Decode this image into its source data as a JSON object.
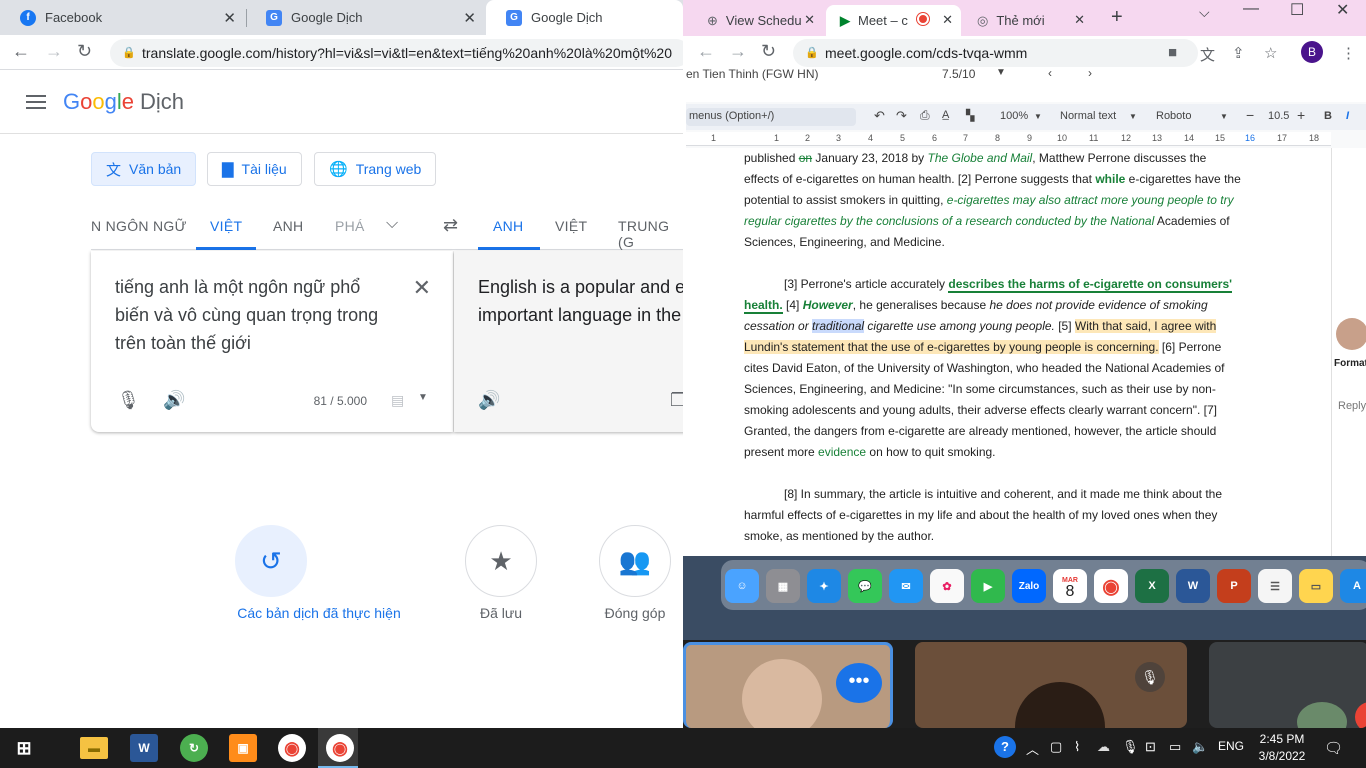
{
  "left_browser": {
    "tabs": [
      {
        "label": "Facebook",
        "icon": "facebook-icon"
      },
      {
        "label": "Google Dịch",
        "icon": "google-translate-icon"
      },
      {
        "label": "Google Dịch",
        "icon": "google-translate-icon"
      }
    ],
    "url": "translate.google.com/history?hl=vi&sl=vi&tl=en&text=tiếng%20anh%20là%20một%20",
    "header": {
      "logo_google": "Google",
      "logo_product": "Dịch"
    },
    "modes": [
      {
        "label": "Văn bản",
        "icon": "translate-icon"
      },
      {
        "label": "Tài liệu",
        "icon": "document-icon"
      },
      {
        "label": "Trang web",
        "icon": "globe-icon"
      }
    ],
    "source_langs": [
      "N NGÔN NGỮ",
      "VIỆT",
      "ANH",
      "PHÁ"
    ],
    "target_langs": [
      "ANH",
      "VIỆT",
      "TRUNG (G"
    ],
    "source_text": "tiếng anh là một ngôn ngữ phổ biến và vô cùng quan trọng trong trên toàn thế giới",
    "target_text_line1": "English is a popular and e",
    "target_text_line2": "important language in the",
    "char_count": "81 / 5.000",
    "shortcuts": [
      {
        "label": "Các bản dịch đã thực hiện",
        "icon": "history-icon"
      },
      {
        "label": "Đã lưu",
        "icon": "star-icon"
      },
      {
        "label": "Đóng góp",
        "icon": "people-icon"
      }
    ]
  },
  "right_browser": {
    "tabs": [
      {
        "label": "View Schedu",
        "icon": "schedule-icon"
      },
      {
        "label": "Meet – c",
        "icon": "meet-icon"
      },
      {
        "label": "Thẻ mới",
        "icon": "chrome-icon"
      }
    ],
    "url": "meet.google.com/cds-tvqa-wmm",
    "avatar_letter": "B",
    "doc": {
      "top_name": "en Tien Thinh (FGW HN)",
      "top_score": "7.5/10",
      "menu_search": "menus (Option+/)",
      "zoom": "100%",
      "style": "Normal text",
      "font": "Roboto",
      "font_size": "10.5",
      "ruler_numbers": [
        "1",
        "1",
        "2",
        "3",
        "4",
        "5",
        "6",
        "7",
        "8",
        "9",
        "10",
        "11",
        "12",
        "13",
        "14",
        "15",
        "16",
        "17",
        "18"
      ],
      "p1_a": "published ",
      "p1_b": "on",
      "p1_c": " January 23, 2018 by ",
      "p1_d": "The Globe and Mail",
      "p1_e": ", Matthew Perrone discusses the effects of e-cigarettes on human health. [2] Perrone suggests that ",
      "p1_f": "while",
      "p1_g": " e-cigarettes have the potential to assist smokers in quitting, ",
      "p1_h": "e-cigarettes may also attract more young people to try regular cigarettes by the conclusions of a research conducted by the National",
      "p1_i": " Academies of Sciences, Engineering, and Medicine.",
      "p2_a": "[3] Perrone's article accurately ",
      "p2_b": "describes the harms of e-cigarette on consumers' health.",
      "p2_c": "[4] ",
      "p2_d": "However",
      "p2_e": ", he generalises because ",
      "p2_f": "he does not provide evidence of smoking cessation or",
      "p2_g": "traditional",
      "p2_h": " cigarette use among young people.",
      "p2_i": " [5] ",
      "p2_j": "With that said, I agree with Lundin's statement that the use of e-cigarettes by young people is concerning.",
      "p2_k": " [6] Perrone cites David Eaton, of the University of Washington, who headed the National Academies of Sciences, Engineering, and Medicine: \"In some circumstances, such as their use by non-smoking adolescents and young adults, their adverse effects clearly warrant concern\". [7] Granted, the dangers from e-cigarette are already mentioned, however, the article should present more ",
      "p2_l": "evidence",
      "p2_m": " on how to quit smoking.",
      "p3": "[8] In summary, the article is intuitive and coherent, and it made me think about the harmful effects of e-cigarettes in my life and about the health of my loved ones when they smoke, as mentioned by the author.",
      "side_format": "Format",
      "side_reply": "Reply"
    }
  },
  "dock": {
    "calendar_month": "MAR",
    "calendar_day": "8",
    "zalo": "Zalo",
    "apps": [
      "finder-icon",
      "launchpad-icon",
      "safari-icon",
      "messages-icon",
      "mail-icon",
      "photos-icon",
      "facetime-icon",
      "zalo-icon",
      "calendar-icon",
      "chrome-icon",
      "excel-icon",
      "word-icon",
      "powerpoint-icon",
      "reminders-icon",
      "notes-icon",
      "appstore-icon"
    ]
  },
  "taskbar": {
    "lang": "ENG",
    "time": "2:45 PM",
    "date": "3/8/2022"
  },
  "colors": {
    "accent": "#1a73e8",
    "doc_green": "#188038",
    "taskbar": "#1c1c1c",
    "meet_tabstrip": "#f6d8f0"
  }
}
